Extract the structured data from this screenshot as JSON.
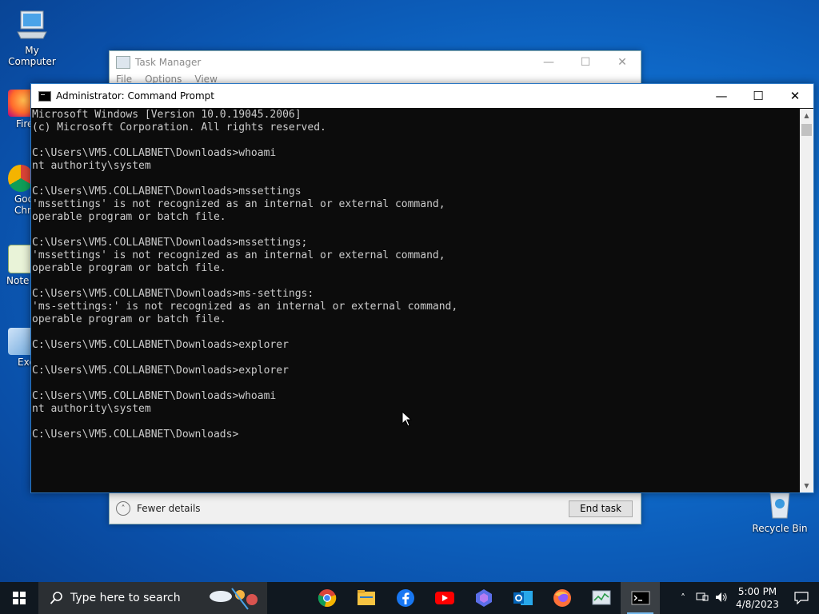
{
  "desktop": {
    "icons": [
      {
        "label": "My Computer"
      },
      {
        "label": "Fire"
      },
      {
        "label": "Goo Chro"
      },
      {
        "label": "Note"
      },
      {
        "label": "Exe"
      },
      {
        "label": "Recycle Bin"
      }
    ]
  },
  "task_manager": {
    "title": "Task Manager",
    "menu": [
      "File",
      "Options",
      "View"
    ],
    "fewer_details": "Fewer details",
    "end_task": "End task"
  },
  "cmd": {
    "title": "Administrator: Command Prompt",
    "lines": [
      "Microsoft Windows [Version 10.0.19045.2006]",
      "(c) Microsoft Corporation. All rights reserved.",
      "",
      "C:\\Users\\VM5.COLLABNET\\Downloads>whoami",
      "nt authority\\system",
      "",
      "C:\\Users\\VM5.COLLABNET\\Downloads>mssettings",
      "'mssettings' is not recognized as an internal or external command,",
      "operable program or batch file.",
      "",
      "C:\\Users\\VM5.COLLABNET\\Downloads>mssettings;",
      "'mssettings' is not recognized as an internal or external command,",
      "operable program or batch file.",
      "",
      "C:\\Users\\VM5.COLLABNET\\Downloads>ms-settings:",
      "'ms-settings:' is not recognized as an internal or external command,",
      "operable program or batch file.",
      "",
      "C:\\Users\\VM5.COLLABNET\\Downloads>explorer",
      "",
      "C:\\Users\\VM5.COLLABNET\\Downloads>explorer",
      "",
      "C:\\Users\\VM5.COLLABNET\\Downloads>whoami",
      "nt authority\\system",
      "",
      "C:\\Users\\VM5.COLLABNET\\Downloads>"
    ]
  },
  "taskbar": {
    "search_placeholder": "Type here to search",
    "apps": [
      "chrome-icon",
      "file-explorer-icon",
      "facebook-icon",
      "youtube-icon",
      "copilot-icon",
      "outlook-icon",
      "firefox-icon",
      "task-manager-icon",
      "command-prompt-icon"
    ],
    "active_app": "command-prompt-icon",
    "time": "5:00 PM",
    "date": "4/8/2023"
  },
  "colors": {
    "console_bg": "#0c0c0c",
    "console_text": "#cccccc",
    "taskbar_bg": "#101820",
    "accent": "#0078d7"
  }
}
